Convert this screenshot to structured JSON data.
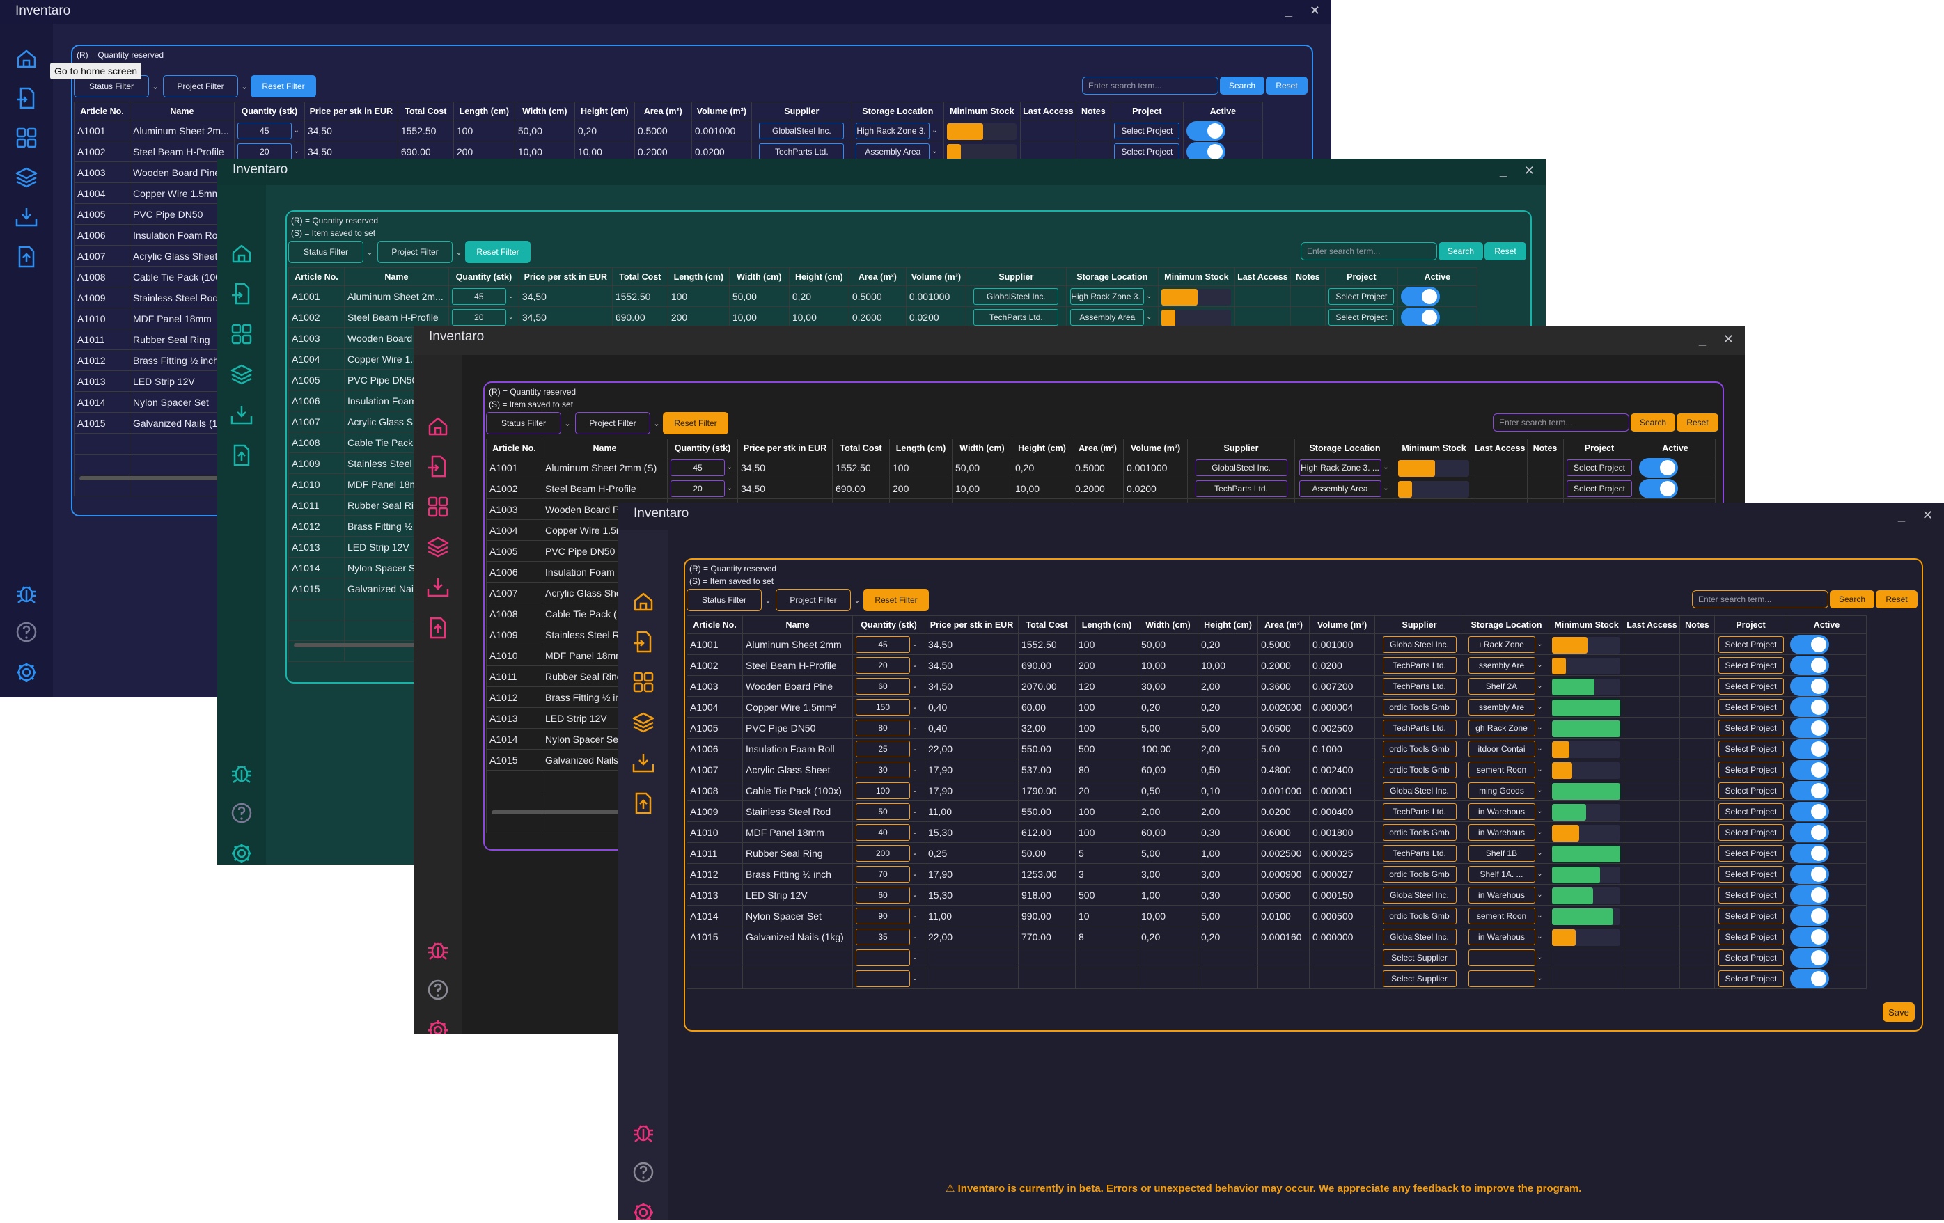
{
  "app": {
    "title": "Inventaro",
    "minimize_glyph": "_",
    "close_glyph": "✕"
  },
  "tooltip": "Go to home screen",
  "legend": {
    "reserved": "(R) = Quantity reserved",
    "saved": "(S) = Item saved to set",
    "saved_partial": "set"
  },
  "filters": {
    "status": "Status Filter",
    "project": "Project Filter",
    "reset": "Reset Filter"
  },
  "search": {
    "placeholder": "Enter search term...",
    "search_button": "Search",
    "reset_button": "Reset"
  },
  "columns": [
    "Article No.",
    "Name",
    "Quantity (stk)",
    "Price per stk in EUR",
    "Total Cost",
    "Length (cm)",
    "Width (cm)",
    "Height (cm)",
    "Area (m²)",
    "Volume (m³)",
    "Supplier",
    "Storage Location",
    "Minimum Stock",
    "Last Access",
    "Notes",
    "Project",
    "Active"
  ],
  "themes": {
    "blue": {
      "bg": "#1e1f42",
      "side": "#18193a",
      "accent": "#2f8ff0",
      "stroke": "#2f8ff0"
    },
    "teal": {
      "bg": "#13403c",
      "side": "#0f3734",
      "accent": "#18b3a8",
      "stroke": "#18b3a8"
    },
    "purple": {
      "bg": "#1e1e1e",
      "side": "#262626",
      "accent": "#f59c0b",
      "stroke": "#8b45e0",
      "icon": "#e8327a"
    },
    "orange": {
      "bg": "#1e1e2e",
      "side": "#242436",
      "accent": "#f59c0b",
      "stroke": "#f59c0b",
      "icon": "#e8327a",
      "stock_ok": "#3ebd6b"
    }
  },
  "sidebar_icons": [
    "home-icon",
    "import-icon",
    "grid-icon",
    "layers-icon",
    "download-icon",
    "export-icon",
    "bug-icon",
    "help-icon",
    "settings-icon"
  ],
  "rows": [
    {
      "art": "A1001",
      "name": "Aluminum Sheet 2mm",
      "name_s": "Aluminum Sheet 2mm (S)",
      "name_b": "Aluminum Sheet 2m...",
      "qty": "45",
      "price": "34,50",
      "total": "1552.50",
      "len": "100",
      "wid": "50,00",
      "hei": "0,20",
      "area": "0.5000",
      "vol": "0.001000",
      "sup": "GlobalSteel Inc.",
      "loc_full": "High Rack Zone 3. ...",
      "loc": "ı Rack Zone",
      "stock": 0.52,
      "stock_color": "#f59c0b",
      "proj": "Select Project"
    },
    {
      "art": "A1002",
      "name": "Steel Beam H-Profile",
      "name_b": "Steel Beam H-Profile",
      "qty": "20",
      "price": "34,50",
      "total": "690.00",
      "len": "200",
      "wid": "10,00",
      "hei": "10,00",
      "area": "0.2000",
      "vol": "0.0200",
      "sup": "TechParts Ltd.",
      "loc_full": "Assembly Area",
      "loc": "ssembly Are",
      "stock": 0.2,
      "stock_color": "#f59c0b",
      "proj": "Select Project"
    },
    {
      "art": "A1003",
      "name": "Wooden Board Pine",
      "qty": "60",
      "price": "34,50",
      "total": "2070.00",
      "len": "120",
      "wid": "30,00",
      "hei": "2,00",
      "area": "0.3600",
      "vol": "0.007200",
      "sup": "TechParts Ltd.",
      "loc": "Shelf 2A",
      "stock": 0.62,
      "stock_color": "#3ebd6b",
      "proj": "Select Project"
    },
    {
      "art": "A1004",
      "name": "Copper Wire 1.5mm²",
      "qty": "150",
      "price": "0,40",
      "total": "60.00",
      "len": "100",
      "wid": "0,20",
      "hei": "0,20",
      "area": "0.002000",
      "vol": "0.000004",
      "sup": "ordic Tools Gmb",
      "loc": "ssembly Are",
      "stock": 1.0,
      "stock_color": "#3ebd6b",
      "proj": "Select Project"
    },
    {
      "art": "A1005",
      "name": "PVC Pipe DN50",
      "qty": "80",
      "price": "0,40",
      "total": "32.00",
      "len": "100",
      "wid": "5,00",
      "hei": "5,00",
      "area": "0.0500",
      "vol": "0.002500",
      "sup": "TechParts Ltd.",
      "loc": "gh Rack Zone",
      "stock": 1.0,
      "stock_color": "#3ebd6b",
      "proj": "Select Project"
    },
    {
      "art": "A1006",
      "name": "Insulation Foam Roll",
      "qty": "25",
      "price": "22,00",
      "total": "550.00",
      "len": "500",
      "wid": "100,00",
      "hei": "2,00",
      "area": "5.00",
      "vol": "0.1000",
      "sup": "ordic Tools Gmb",
      "loc": "itdoor Contai",
      "stock": 0.25,
      "stock_color": "#f59c0b",
      "proj": "Select Project"
    },
    {
      "art": "A1007",
      "name": "Acrylic Glass Sheet",
      "qty": "30",
      "price": "17,90",
      "total": "537.00",
      "len": "80",
      "wid": "60,00",
      "hei": "0,50",
      "area": "0.4800",
      "vol": "0.002400",
      "sup": "ordic Tools Gmb",
      "loc": "sement Roon",
      "stock": 0.3,
      "stock_color": "#f59c0b",
      "proj": "Select Project"
    },
    {
      "art": "A1008",
      "name": "Cable Tie Pack (100x)",
      "qty": "100",
      "price": "17,90",
      "total": "1790.00",
      "len": "20",
      "wid": "0,50",
      "hei": "0,10",
      "area": "0.001000",
      "vol": "0.000001",
      "sup": "GlobalSteel Inc.",
      "loc": "ming Goods",
      "stock": 1.0,
      "stock_color": "#3ebd6b",
      "proj": "Select Project"
    },
    {
      "art": "A1009",
      "name": "Stainless Steel Rod",
      "qty": "50",
      "price": "11,00",
      "total": "550.00",
      "len": "100",
      "wid": "2,00",
      "hei": "2,00",
      "area": "0.0200",
      "vol": "0.000400",
      "sup": "TechParts Ltd.",
      "loc": "in Warehous",
      "stock": 0.5,
      "stock_color": "#3ebd6b",
      "proj": "Select Project"
    },
    {
      "art": "A1010",
      "name": "MDF Panel 18mm",
      "qty": "40",
      "price": "15,30",
      "total": "612.00",
      "len": "100",
      "wid": "60,00",
      "hei": "0,30",
      "area": "0.6000",
      "vol": "0.001800",
      "sup": "ordic Tools Gmb",
      "loc": "in Warehous",
      "stock": 0.4,
      "stock_color": "#f59c0b",
      "proj": "Select Project"
    },
    {
      "art": "A1011",
      "name": "Rubber Seal Ring",
      "qty": "200",
      "price": "0,25",
      "total": "50.00",
      "len": "5",
      "wid": "5,00",
      "hei": "1,00",
      "area": "0.002500",
      "vol": "0.000025",
      "sup": "TechParts Ltd.",
      "loc": "Shelf 1B",
      "stock": 1.0,
      "stock_color": "#3ebd6b",
      "proj": "Select Project"
    },
    {
      "art": "A1012",
      "name": "Brass Fitting ½ inch",
      "qty": "70",
      "price": "17,90",
      "total": "1253.00",
      "len": "3",
      "wid": "3,00",
      "hei": "3,00",
      "area": "0.000900",
      "vol": "0.000027",
      "sup": "ordic Tools Gmb",
      "loc": "Shelf 1A. ...",
      "stock": 0.7,
      "stock_color": "#3ebd6b",
      "proj": "Select Project"
    },
    {
      "art": "A1013",
      "name": "LED Strip 12V",
      "qty": "60",
      "price": "15,30",
      "total": "918.00",
      "len": "500",
      "wid": "1,00",
      "hei": "0,30",
      "area": "0.0500",
      "vol": "0.000150",
      "sup": "GlobalSteel Inc.",
      "loc": "in Warehous",
      "stock": 0.6,
      "stock_color": "#3ebd6b",
      "proj": "Select Project"
    },
    {
      "art": "A1014",
      "name": "Nylon Spacer Set",
      "qty": "90",
      "price": "11,00",
      "total": "990.00",
      "len": "10",
      "wid": "10,00",
      "hei": "5,00",
      "area": "0.0100",
      "vol": "0.000500",
      "sup": "ordic Tools Gmb",
      "loc": "sement Roon",
      "stock": 0.9,
      "stock_color": "#3ebd6b",
      "proj": "Select Project"
    },
    {
      "art": "A1015",
      "name": "Galvanized Nails (1kg)",
      "qty": "35",
      "price": "22,00",
      "total": "770.00",
      "len": "8",
      "wid": "0,20",
      "hei": "0,20",
      "area": "0.000160",
      "vol": "0.000000",
      "sup": "GlobalSteel Inc.",
      "loc": "in Warehous",
      "stock": 0.35,
      "stock_color": "#f59c0b",
      "proj": "Select Project"
    }
  ],
  "empty_row": {
    "sup": "Select Supplier",
    "proj": "Select Project"
  },
  "save": "Save",
  "beta": "Inventaro is currently in beta. Errors or unexpected behavior may occur. We appreciate any feedback to improve the program."
}
